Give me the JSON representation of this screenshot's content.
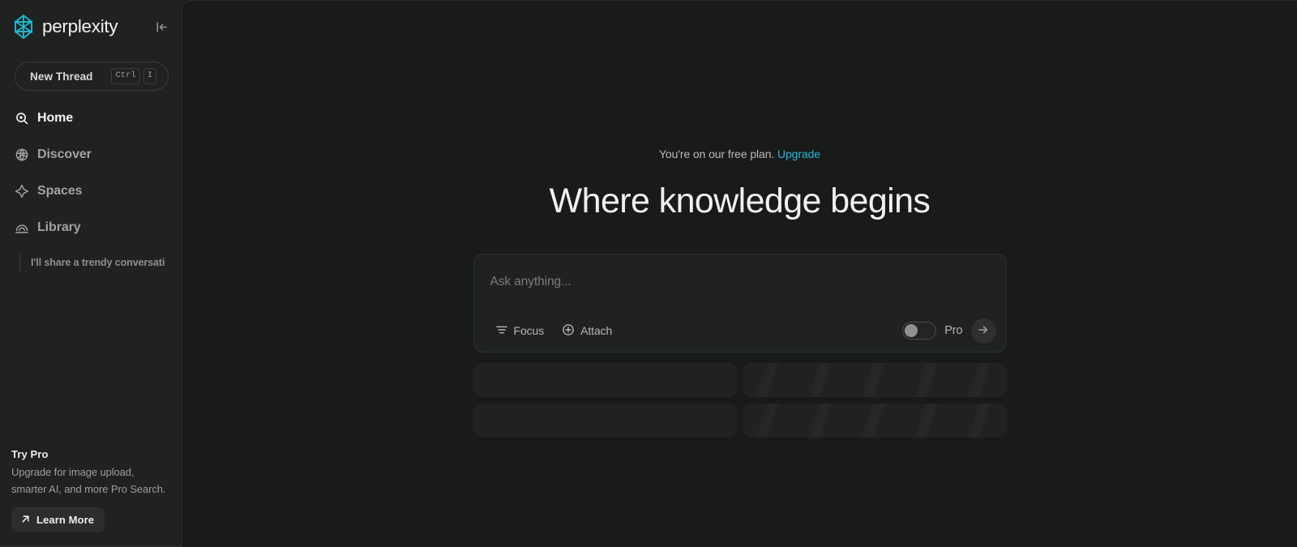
{
  "brand": {
    "name": "perplexity",
    "logo_icon": "perplexity-logo-icon",
    "logo_color": "#20b8cd",
    "collapse_icon": "collapse-sidebar-icon"
  },
  "sidebar": {
    "new_thread": {
      "label": "New Thread",
      "shortcut_keys": [
        "Ctrl",
        "I"
      ]
    },
    "nav": [
      {
        "label": "Home",
        "icon": "search-home-icon",
        "active": true
      },
      {
        "label": "Discover",
        "icon": "globe-icon",
        "active": false
      },
      {
        "label": "Spaces",
        "icon": "sparkle-icon",
        "active": false
      },
      {
        "label": "Library",
        "icon": "library-arc-icon",
        "active": false
      }
    ],
    "threads": [
      {
        "title": "I'll share a trendy conversati"
      }
    ],
    "promo": {
      "title": "Try Pro",
      "description": "Upgrade for image upload, smarter AI, and more Pro Search.",
      "button_label": "Learn More",
      "button_icon": "arrow-up-right-icon"
    }
  },
  "main": {
    "plan_notice": {
      "text": "You're on our free plan.",
      "link_label": "Upgrade",
      "link_color": "#29b6d8"
    },
    "hero_title": "Where knowledge begins",
    "ask": {
      "placeholder": "Ask anything...",
      "value": "",
      "focus_label": "Focus",
      "focus_icon": "filter-lines-icon",
      "attach_label": "Attach",
      "attach_icon": "circle-plus-icon",
      "pro_label": "Pro",
      "pro_enabled": false,
      "submit_icon": "arrow-right-icon"
    },
    "skeleton_cards": [
      {
        "shimmer": false
      },
      {
        "shimmer": true
      },
      {
        "shimmer": false
      },
      {
        "shimmer": true
      }
    ]
  }
}
